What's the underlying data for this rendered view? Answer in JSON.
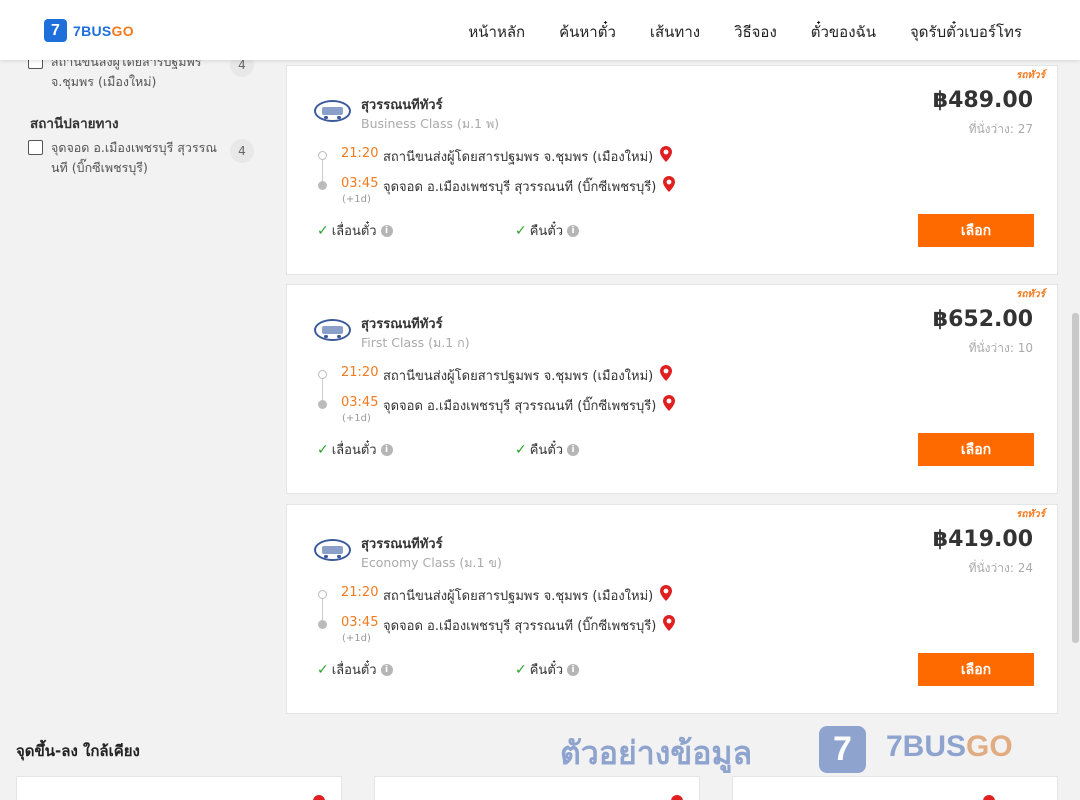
{
  "brand": {
    "logo_mark": "7",
    "name_a": "7BUS",
    "name_b": "GO"
  },
  "nav": [
    {
      "label": "หน้าหลัก"
    },
    {
      "label": "ค้นหาตั๋ว"
    },
    {
      "label": "เส้นทาง"
    },
    {
      "label": "วิธีจอง"
    },
    {
      "label": "ตั๋วของฉัน"
    },
    {
      "label": "จุดรับตั๋วเบอร์โทร"
    }
  ],
  "sidebar": {
    "origin_filter": {
      "label": "สถานีขนส่งผู้โดยสารปฐมพร จ.ชุมพร (เมืองใหม่)",
      "count": "4"
    },
    "destination_title": "สถานีปลายทาง",
    "destination_filter": {
      "label": "จุดจอด อ.เมืองเพชรบุรี สุวรรณนที (บิ๊กซีเพชรบุรี)",
      "count": "4"
    }
  },
  "trips": [
    {
      "tag": "รถทัวร์",
      "operator": "สุวรรณนทีทัวร์",
      "class": "Business Class (ม.1 พ)",
      "price": "฿489.00",
      "seats": "ที่นั่งว่าง: 27",
      "depart_time": "21:20",
      "depart_stop": "สถานีขนส่งผู้โดยสารปฐมพร จ.ชุมพร (เมืองใหม่)",
      "arrive_time": "03:45",
      "arrive_stop": "จุดจอด อ.เมืองเพชรบุรี สุวรรณนที (บิ๊กซีเพชรบุรี)",
      "plus_day": "(+1d)",
      "feature_change": "เลื่อนตั๋ว",
      "feature_refund": "คืนตั๋ว",
      "select_label": "เลือก"
    },
    {
      "tag": "รถทัวร์",
      "operator": "สุวรรณนทีทัวร์",
      "class": "First Class (ม.1 ก)",
      "price": "฿652.00",
      "seats": "ที่นั่งว่าง: 10",
      "depart_time": "21:20",
      "depart_stop": "สถานีขนส่งผู้โดยสารปฐมพร จ.ชุมพร (เมืองใหม่)",
      "arrive_time": "03:45",
      "arrive_stop": "จุดจอด อ.เมืองเพชรบุรี สุวรรณนที (บิ๊กซีเพชรบุรี)",
      "plus_day": "(+1d)",
      "feature_change": "เลื่อนตั๋ว",
      "feature_refund": "คืนตั๋ว",
      "select_label": "เลือก"
    },
    {
      "tag": "รถทัวร์",
      "operator": "สุวรรณนทีทัวร์",
      "class": "Economy Class (ม.1 ข)",
      "price": "฿419.00",
      "seats": "ที่นั่งว่าง: 24",
      "depart_time": "21:20",
      "depart_stop": "สถานีขนส่งผู้โดยสารปฐมพร จ.ชุมพร (เมืองใหม่)",
      "arrive_time": "03:45",
      "arrive_stop": "จุดจอด อ.เมืองเพชรบุรี สุวรรณนที (บิ๊กซีเพชรบุรี)",
      "plus_day": "(+1d)",
      "feature_change": "เลื่อนตั๋ว",
      "feature_refund": "คืนตั๋ว",
      "select_label": "เลือก"
    }
  ],
  "nearby_title": "จุดขึ้น-ลง ใกล้เคียง",
  "watermark": {
    "text": "ตัวอย่างข้อมูล",
    "logo_mark": "7",
    "brand_a": "7BUS",
    "brand_b": "GO"
  },
  "colors": {
    "accent": "#ff6a00",
    "brand_blue": "#1e6fd9",
    "time_orange": "#f47a1f",
    "check_green": "#2aa52a"
  }
}
